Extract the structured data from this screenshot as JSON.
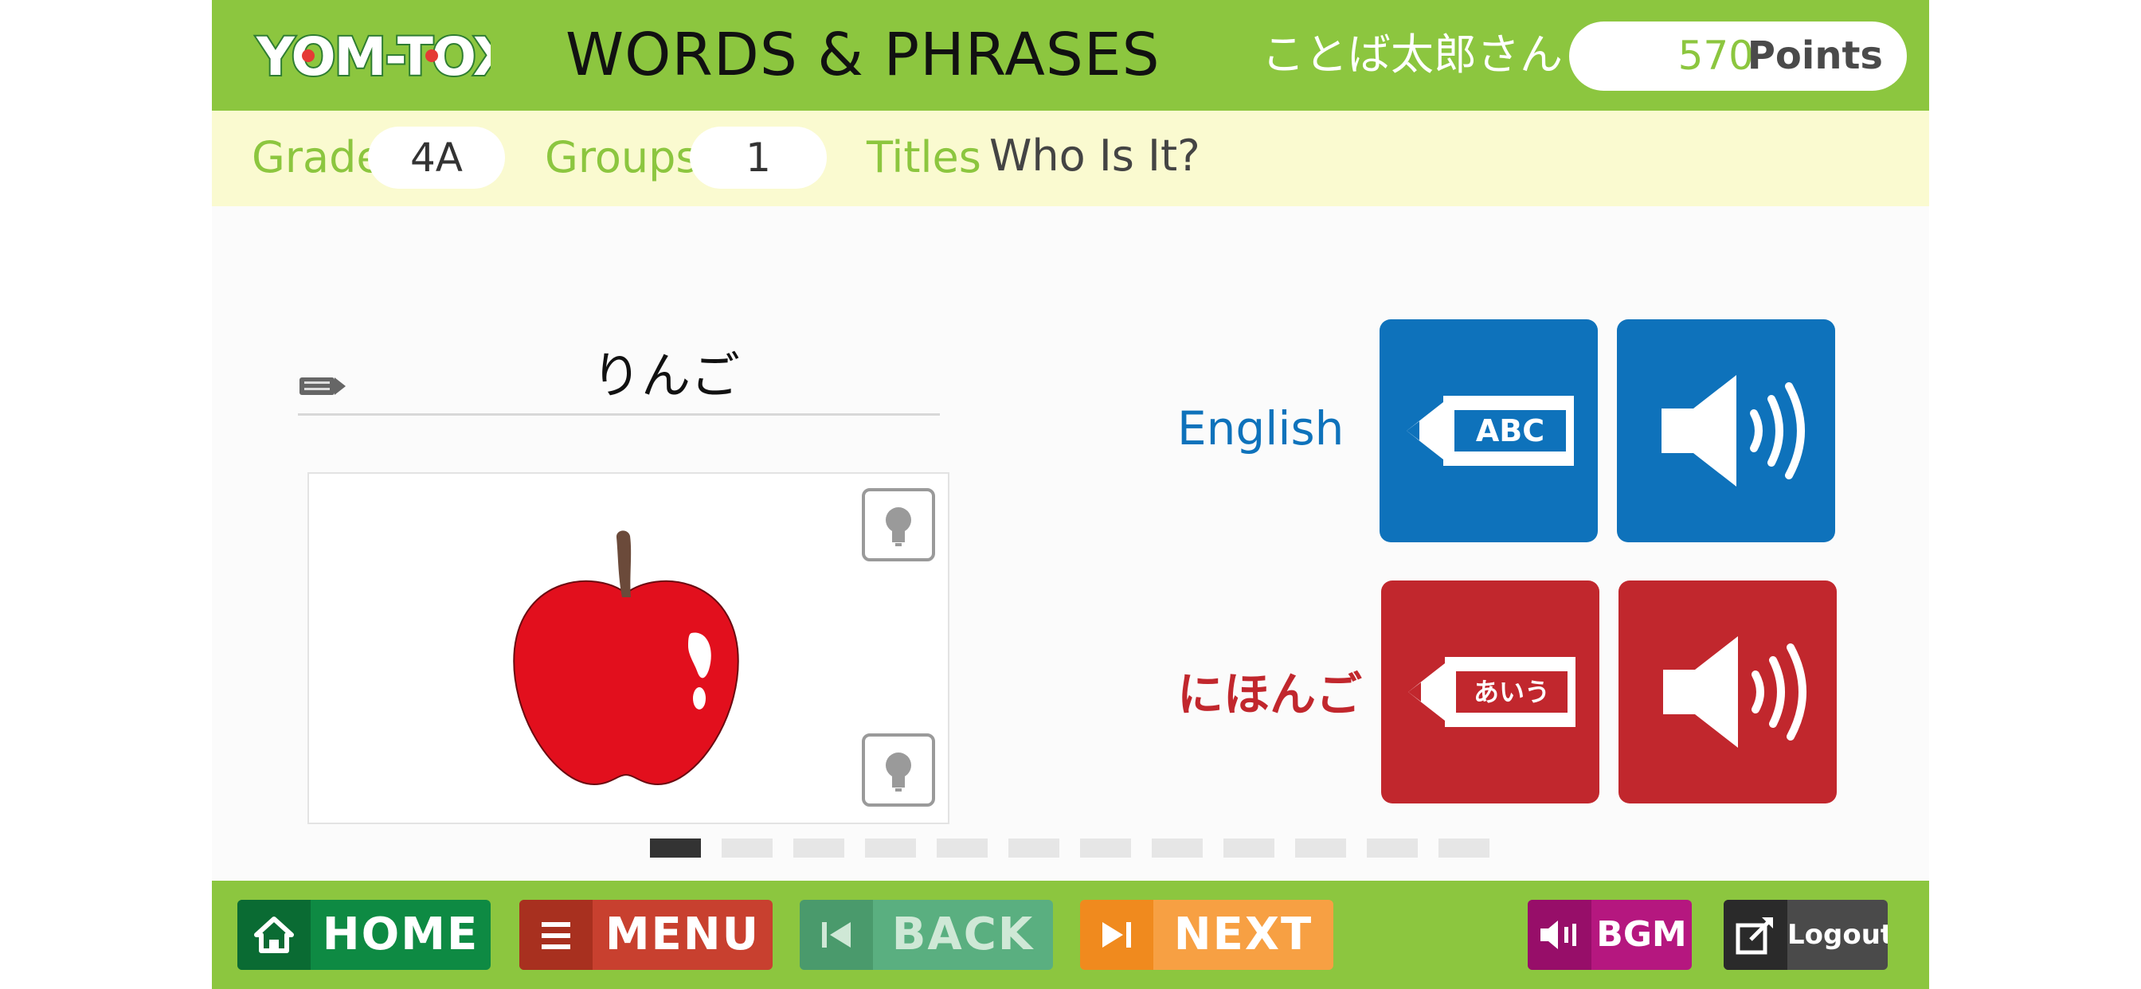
{
  "header": {
    "logo_text": "YOM-TOX",
    "title": "WORDS & PHRASES",
    "user_name": "ことば太郎さん",
    "points_value": "570",
    "points_label": "Points"
  },
  "info": {
    "grade_label": "Grade",
    "grade_value": "4A",
    "groups_label": "Groups",
    "groups_value": "1",
    "titles_label": "Titles",
    "title_value": "Who Is It?"
  },
  "card": {
    "word": "りんご",
    "image": "apple"
  },
  "languages": [
    {
      "label": "English",
      "write_text": "ABC",
      "color": "#0e72bb"
    },
    {
      "label": "にほんご",
      "write_text": "あいう",
      "color": "#c1272d"
    }
  ],
  "pager": {
    "total": 12,
    "current": 1
  },
  "footer": {
    "home_label": "HOME",
    "menu_label": "MENU",
    "back_label": "BACK",
    "next_label": "NEXT",
    "bgm_label": "BGM",
    "logout_label": "Logout"
  },
  "colors": {
    "brand_green": "#8cc63f",
    "info_bg": "#fafad0",
    "english_blue": "#0e72bb",
    "japanese_red": "#c1272d",
    "home": "#0e8a43",
    "menu": "#c8402f",
    "back": "#5aaf80",
    "next": "#f7a043",
    "bgm": "#b5177f",
    "logout": "#4a4a4a"
  }
}
